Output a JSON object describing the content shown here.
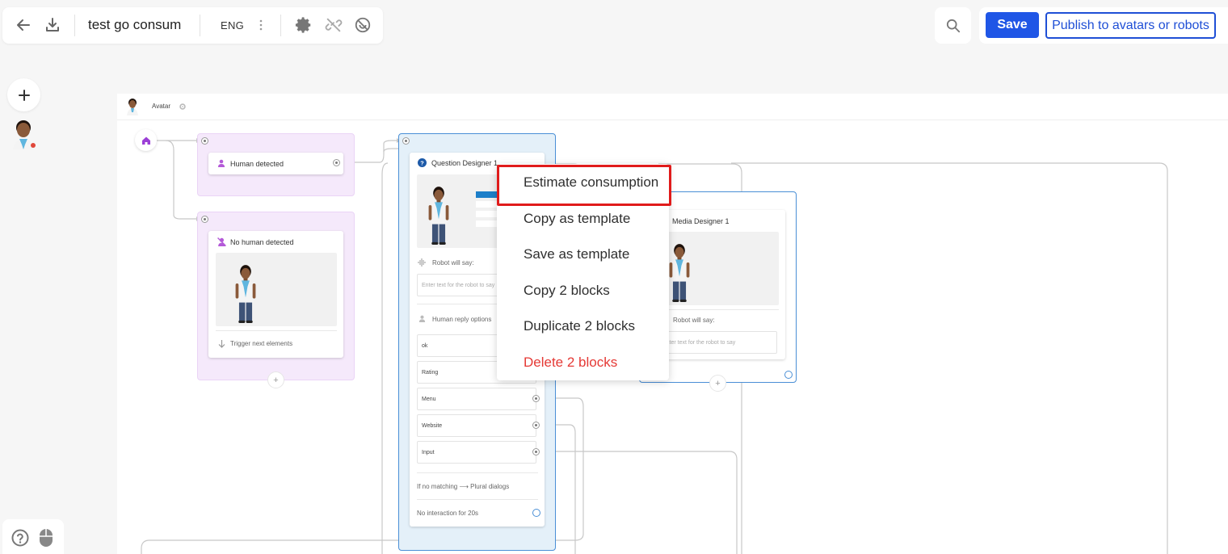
{
  "toolbar": {
    "title": "test go consum",
    "language": "ENG"
  },
  "actions": {
    "save_label": "Save",
    "publish_label": "Publish to avatars or robots"
  },
  "canvas": {
    "header_label": "Avatar"
  },
  "blocks": {
    "human_detected": "Human detected",
    "no_human_detected": "No human detected",
    "trigger_next": "Trigger next elements",
    "question_designer": "Question Designer 1",
    "robot_will_say": "Robot will say:",
    "enter_text_placeholder": "Enter text for the robot to say",
    "human_reply_options": "Human reply options",
    "options": [
      "ok",
      "Rating",
      "Menu",
      "Website",
      "Input"
    ],
    "no_matching": "If no matching ⟶ Plural dialogs",
    "no_interaction": "No interaction for 20s",
    "media_designer": "Media Designer 1",
    "media_robot_will_say": "Robot will say:",
    "media_enter_text": "Enter text for the robot to say"
  },
  "context_menu": {
    "items": [
      {
        "label": "Estimate consumption"
      },
      {
        "label": "Copy as template"
      },
      {
        "label": "Save as template"
      },
      {
        "label": "Copy 2 blocks"
      },
      {
        "label": "Duplicate 2 blocks"
      },
      {
        "label": "Delete 2 blocks"
      }
    ]
  },
  "colors": {
    "accent": "#1f56e6",
    "danger": "#e53935",
    "highlight_border": "#e01b1b",
    "group_purple": "#f5e9fb",
    "group_blue": "#e4f0f9"
  }
}
